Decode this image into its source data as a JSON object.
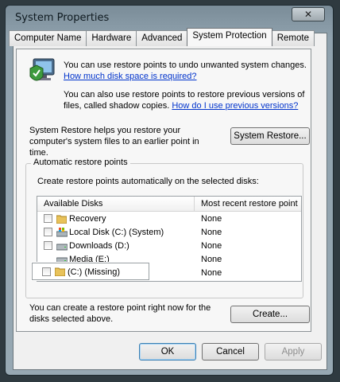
{
  "window": {
    "title": "System Properties",
    "close_glyph": "✕"
  },
  "tabs": [
    {
      "label": "Computer Name",
      "active": false
    },
    {
      "label": "Hardware",
      "active": false
    },
    {
      "label": "Advanced",
      "active": false
    },
    {
      "label": "System Protection",
      "active": true
    },
    {
      "label": "Remote",
      "active": false
    }
  ],
  "intro": {
    "p1_text": "You can use restore points to undo unwanted system changes.",
    "p1_link": "How much disk space is required?",
    "p2_text": "You can also use restore points to restore previous versions of files, called shadow copies.",
    "p2_link": "How do I use previous versions?"
  },
  "system_restore": {
    "description": "System Restore helps you restore your computer's system files to an earlier point in time.",
    "button_label": "System Restore..."
  },
  "auto_restore": {
    "group_label": "Automatic restore points",
    "instruction": "Create restore points automatically on the selected disks:",
    "columns": [
      "Available Disks",
      "Most recent restore point"
    ],
    "disks": [
      {
        "name": "Recovery",
        "point": "None",
        "icon": "folder-icon",
        "checkbox": true
      },
      {
        "name": "Local Disk (C:) (System)",
        "point": "None",
        "icon": "system-drive-icon",
        "checkbox": true
      },
      {
        "name": "Downloads (D:)",
        "point": "None",
        "icon": "drive-icon",
        "checkbox": true
      },
      {
        "name": "Media (E:)",
        "point": "None",
        "icon": "drive-icon",
        "checkbox": false
      },
      {
        "name": "(C:) (Missing)",
        "point": "None",
        "icon": "folder-icon",
        "checkbox": true
      }
    ]
  },
  "create": {
    "description": "You can create a restore point right now for the disks selected above.",
    "button_label": "Create..."
  },
  "dialog_buttons": {
    "ok": "OK",
    "cancel": "Cancel",
    "apply": "Apply"
  }
}
